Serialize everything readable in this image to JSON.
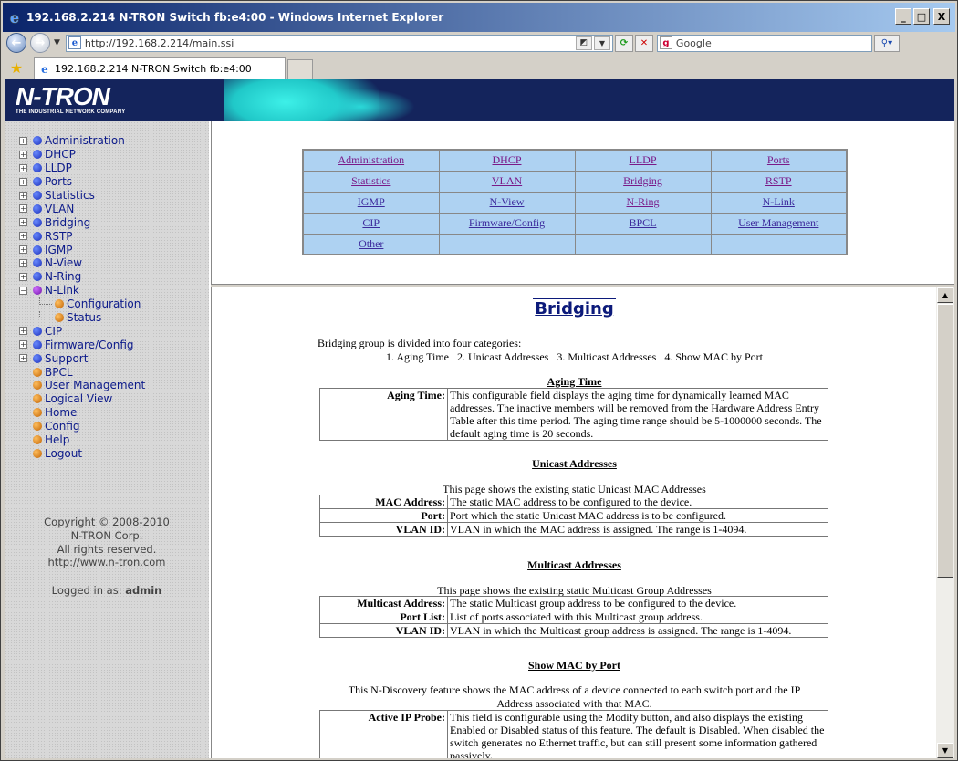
{
  "window": {
    "title": "192.168.2.214 N-TRON Switch fb:e4:00 - Windows Internet Explorer",
    "minimize": "_",
    "maximize": "□",
    "close": "X"
  },
  "address": {
    "url": "http://192.168.2.214/main.ssi",
    "search_placeholder": "Google"
  },
  "tab": {
    "label": "192.168.2.214 N-TRON Switch fb:e4:00"
  },
  "logo": {
    "name": "N-TRON",
    "tagline": "THE INDUSTRIAL NETWORK COMPANY"
  },
  "sidebar": {
    "items": [
      {
        "label": "Administration",
        "dot": "blue",
        "expand": "+"
      },
      {
        "label": "DHCP",
        "dot": "blue",
        "expand": "+"
      },
      {
        "label": "LLDP",
        "dot": "blue",
        "expand": "+"
      },
      {
        "label": "Ports",
        "dot": "blue",
        "expand": "+"
      },
      {
        "label": "Statistics",
        "dot": "blue",
        "expand": "+"
      },
      {
        "label": "VLAN",
        "dot": "blue",
        "expand": "+"
      },
      {
        "label": "Bridging",
        "dot": "blue",
        "expand": "+"
      },
      {
        "label": "RSTP",
        "dot": "blue",
        "expand": "+"
      },
      {
        "label": "IGMP",
        "dot": "blue",
        "expand": "+"
      },
      {
        "label": "N-View",
        "dot": "blue",
        "expand": "+"
      },
      {
        "label": "N-Ring",
        "dot": "blue",
        "expand": "+"
      },
      {
        "label": "N-Link",
        "dot": "purple",
        "expand": "−"
      },
      {
        "label": "Configuration",
        "dot": "orange",
        "child": true
      },
      {
        "label": "Status",
        "dot": "orange",
        "child": true
      },
      {
        "label": "CIP",
        "dot": "blue",
        "expand": "+"
      },
      {
        "label": "Firmware/Config",
        "dot": "blue",
        "expand": "+"
      },
      {
        "label": "Support",
        "dot": "blue",
        "expand": "+"
      },
      {
        "label": "BPCL",
        "dot": "orange"
      },
      {
        "label": "User Management",
        "dot": "orange"
      },
      {
        "label": "Logical View",
        "dot": "orange"
      },
      {
        "label": "Home",
        "dot": "orange"
      },
      {
        "label": "Config",
        "dot": "orange"
      },
      {
        "label": "Help",
        "dot": "orange"
      },
      {
        "label": "Logout",
        "dot": "orange"
      }
    ],
    "copyright": [
      "Copyright © 2008-2010",
      "N-TRON Corp.",
      "All rights reserved.",
      "http://www.n-tron.com"
    ],
    "logged_in_label": "Logged in as:",
    "logged_in_user": "admin"
  },
  "nav": {
    "rows": [
      [
        {
          "label": "Administration",
          "visited": true
        },
        {
          "label": "DHCP",
          "visited": true
        },
        {
          "label": "LLDP",
          "visited": true
        },
        {
          "label": "Ports",
          "visited": true
        }
      ],
      [
        {
          "label": "Statistics",
          "visited": true
        },
        {
          "label": "VLAN",
          "visited": true
        },
        {
          "label": "Bridging",
          "visited": true
        },
        {
          "label": "RSTP",
          "visited": true
        }
      ],
      [
        {
          "label": "IGMP"
        },
        {
          "label": "N-View"
        },
        {
          "label": "N-Ring",
          "visited": true
        },
        {
          "label": "N-Link"
        }
      ],
      [
        {
          "label": "CIP"
        },
        {
          "label": "Firmware/Config"
        },
        {
          "label": "BPCL"
        },
        {
          "label": "User Management"
        }
      ],
      [
        {
          "label": "Other"
        },
        {
          "label": ""
        },
        {
          "label": ""
        },
        {
          "label": ""
        }
      ]
    ]
  },
  "main": {
    "title": "Bridging",
    "intro": "Bridging group is divided into four categories:",
    "categories": "1. Aging Time   2. Unicast Addresses   3. Multicast Addresses   4. Show MAC by Port",
    "aging": {
      "heading": "Aging Time",
      "rows": [
        {
          "key": "Aging Time:",
          "value": "This configurable field displays the aging time for dynamically learned MAC addresses. The inactive members will be removed from the Hardware Address Entry Table after this time period. The aging time range should be 5-1000000 seconds. The default aging time is 20 seconds."
        }
      ]
    },
    "unicast": {
      "heading": "Unicast Addresses",
      "desc": "This page shows the existing static Unicast MAC Addresses",
      "rows": [
        {
          "key": "MAC Address:",
          "value": "The static MAC address to be configured to the device."
        },
        {
          "key": "Port:",
          "value": "Port which the static Unicast MAC address is to be configured."
        },
        {
          "key": "VLAN ID:",
          "value": "VLAN in which the MAC address is assigned. The range is 1-4094."
        }
      ]
    },
    "multicast": {
      "heading": "Multicast Addresses",
      "desc": "This page shows the existing static Multicast Group Addresses",
      "rows": [
        {
          "key": "Multicast Address:",
          "value": "The static Multicast group address to be configured to the device."
        },
        {
          "key": "Port List:",
          "value": "List of ports associated with this Multicast group address."
        },
        {
          "key": "VLAN ID:",
          "value": "VLAN in which the Multicast group address is assigned. The range is 1-4094."
        }
      ]
    },
    "showmac": {
      "heading": "Show MAC by Port",
      "desc": "This N-Discovery feature shows the MAC address of a device connected to each switch port and the IP Address associated with that MAC.",
      "rows": [
        {
          "key": "Active IP Probe:",
          "value": "This field is configurable using the Modify button, and also displays the existing Enabled or Disabled status of this feature. The default is Disabled. When disabled the switch generates no Ethernet traffic, but can still present some information gathered passively."
        }
      ]
    }
  }
}
